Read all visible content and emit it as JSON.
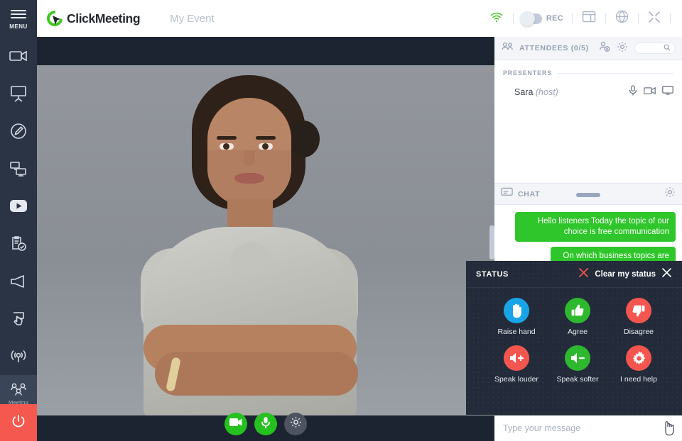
{
  "app": {
    "brand": "ClickMeeting",
    "event_title": "My Event"
  },
  "sidebar": {
    "menu_label": "MENU",
    "items": [
      {
        "name": "camera",
        "icon": "video-camera-icon"
      },
      {
        "name": "presentation",
        "icon": "presentation-screen-icon"
      },
      {
        "name": "whiteboard",
        "icon": "pencil-circle-icon"
      },
      {
        "name": "screen-share",
        "icon": "screen-share-icon"
      },
      {
        "name": "youtube",
        "icon": "youtube-play-icon"
      },
      {
        "name": "tests",
        "icon": "clipboard-check-icon"
      },
      {
        "name": "call-to-action",
        "icon": "megaphone-icon"
      },
      {
        "name": "interaction",
        "icon": "hand-click-icon"
      },
      {
        "name": "broadcast",
        "icon": "broadcast-icon"
      },
      {
        "name": "meeting",
        "icon": "people-group-icon",
        "label": "Meeting",
        "active": true
      }
    ],
    "power_label": "power-icon"
  },
  "topbar": {
    "connection_icon": "wifi-signal-icon",
    "rec_label": "REC",
    "rec_on": false,
    "layout_icon": "layout-icon",
    "language_icon": "globe-icon",
    "fullscreen_icon": "fullscreen-icon"
  },
  "video": {
    "camera_icon": "video-camera-icon",
    "mic_icon": "microphone-icon",
    "settings_icon": "gear-icon",
    "camera_on": true,
    "mic_on": true
  },
  "attendees": {
    "title": "ATTENDEES (0/5)",
    "count_current": 0,
    "count_max": 5,
    "add_icon": "add-person-icon",
    "settings_icon": "gear-icon",
    "search_icon": "search-icon",
    "group_label": "PRESENTERS",
    "presenters": [
      {
        "name": "Sara",
        "role": "(host)",
        "mic_icon": "microphone-icon",
        "camera_icon": "video-camera-icon",
        "screen_icon": "monitor-icon"
      }
    ]
  },
  "chat": {
    "title": "CHAT",
    "settings_icon": "gear-icon",
    "messages": [
      {
        "text": "Hello listeners Today the topic of our choice is free communication"
      },
      {
        "text": "On which business topics are raised"
      }
    ],
    "input_placeholder": "Type your message"
  },
  "status": {
    "title": "STATUS",
    "clear_label": "Clear my status",
    "clear_icon": "red-x-icon",
    "close_icon": "close-x-icon",
    "options": [
      {
        "label": "Raise hand",
        "icon": "raised-hand-icon",
        "color": "#19a4e8"
      },
      {
        "label": "Agree",
        "icon": "thumbs-up-icon",
        "color": "#2eb82e"
      },
      {
        "label": "Disagree",
        "icon": "thumbs-down-icon",
        "color": "#f4564f"
      },
      {
        "label": "Speak louder",
        "icon": "speaker-plus-icon",
        "color": "#f4564f"
      },
      {
        "label": "Speak softer",
        "icon": "speaker-minus-icon",
        "color": "#2eb82e"
      },
      {
        "label": "I need help",
        "icon": "gear-help-icon",
        "color": "#f4564f"
      }
    ]
  },
  "colors": {
    "brand_green": "#3ec91e",
    "chat_bubble": "#2ec62a",
    "sidebar_bg": "#2b3445",
    "power_red": "#f4584f",
    "panel_dark": "#232b3a"
  }
}
